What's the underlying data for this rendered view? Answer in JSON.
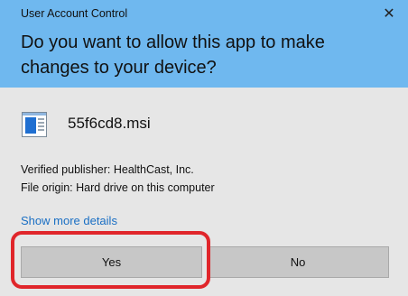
{
  "window": {
    "title": "User Account Control",
    "close_icon": "close-icon"
  },
  "prompt": {
    "question": "Do you want to allow this app to make changes to your device?"
  },
  "app": {
    "icon": "installer-file-icon",
    "filename": "55f6cd8.msi"
  },
  "details": {
    "publisher": "Verified publisher: HealthCast, Inc.",
    "origin": "File origin: Hard drive on this computer",
    "show_more": "Show more details"
  },
  "buttons": {
    "yes": "Yes",
    "no": "No"
  },
  "colors": {
    "header": "#6fb8ef",
    "body": "#e6e6e6",
    "link": "#1a6fc4",
    "highlight": "#e0262b"
  }
}
